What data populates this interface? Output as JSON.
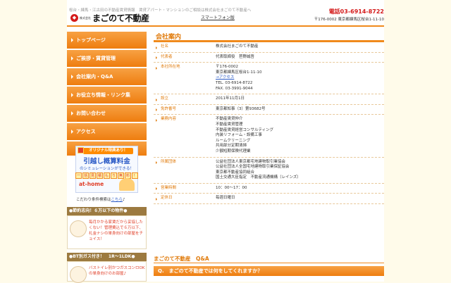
{
  "header": {
    "tagline": "桜台・練馬・江古田の不動産賃貸情報　賃貸アパート・マンションのご相談は株式会社まごのて不動産へ",
    "logo_prefix": "株式会社",
    "logo_name": "まごのて不動産",
    "smartphone_link": "スマートフォン版",
    "tel": "電話03-6914-8722",
    "address": "〒176-0002 東京都練馬区桜台1-11-10"
  },
  "nav": {
    "items": [
      {
        "label": "トップページ"
      },
      {
        "label": "ご挨拶・賃貸管理"
      },
      {
        "label": "会社案内・Q&A"
      },
      {
        "label": "お役立ち情報・リンク集"
      },
      {
        "label": "お問い合わせ"
      },
      {
        "label": "アクセス"
      }
    ]
  },
  "banner": {
    "top": "オリジナル特典あり！",
    "big": "引越し概算料金",
    "small": "のシミュレーションができる！",
    "tags": [
      "一",
      "括",
      "見",
      "積",
      "も",
      "り",
      "無",
      "料",
      "！"
    ],
    "logo": "at-home"
  },
  "kodawari": {
    "prefix": "こだわり条件検索は",
    "link": "こちら",
    "suffix": "♪"
  },
  "side": {
    "section1": {
      "title": "●節約志向！６万以下の物件●",
      "text": "毎月かかる家賃だから妥協したくない！管理費込で６万以下、礼金ナシの単身向けの部屋をチョイス！"
    },
    "section2": {
      "title": "●BT別ガス付き！　1R～1LDK●",
      "text": "バストイレ別かつガスコンロOKの単身向けのお部屋♪"
    }
  },
  "content": {
    "title": "会社案内",
    "rows": [
      {
        "key": "社名",
        "lines": [
          "株式会社まごのて不動産"
        ]
      },
      {
        "key": "代表者",
        "lines": [
          "代表取締役　苣野誠吾"
        ]
      },
      {
        "key": "本社所在地",
        "lines": [
          "〒176-0002",
          "東京都練馬区桜台1-11-10"
        ],
        "link": "→アクセス",
        "after": [
          "TEL. 03-6914-8722",
          "FAX. 03-3991-9044"
        ]
      },
      {
        "key": "設立",
        "lines": [
          "2011年11月1日"
        ]
      },
      {
        "key": "免許番号",
        "lines": [
          "東京都知事（3）第93682号"
        ]
      },
      {
        "key": "業務内容",
        "lines": [
          "不動産賃貸仲介",
          "不動産賃貸管理",
          "不動産賃貸経営コンサルティング",
          "内装リフォーム・設備工事",
          "ルームクリーニング",
          "共用部分定期清掃",
          "少額短期保険代理業"
        ]
      },
      {
        "key": "所属団体",
        "lines": [
          "公益社団法人東京都宅地建物取引業協会",
          "公益社団法人全国宅地建物取引業保証協会",
          "東京都不動産協同組合",
          "国土交通大臣指定　不動産流通機構（レインズ）"
        ]
      },
      {
        "key": "営業時間",
        "lines": [
          "10：00～17：00"
        ]
      },
      {
        "key": "定休日",
        "lines": [
          "毎週日曜日"
        ]
      }
    ]
  },
  "qa": {
    "title": "まごのて不動産　Q&A",
    "question": "Q.　まごのて不動産では何をしてくれますか？"
  },
  "colors": {
    "accent": "#f08a1c",
    "brand_red": "#d41a1a",
    "link": "#2a5ac6",
    "background": "#fffbea"
  }
}
